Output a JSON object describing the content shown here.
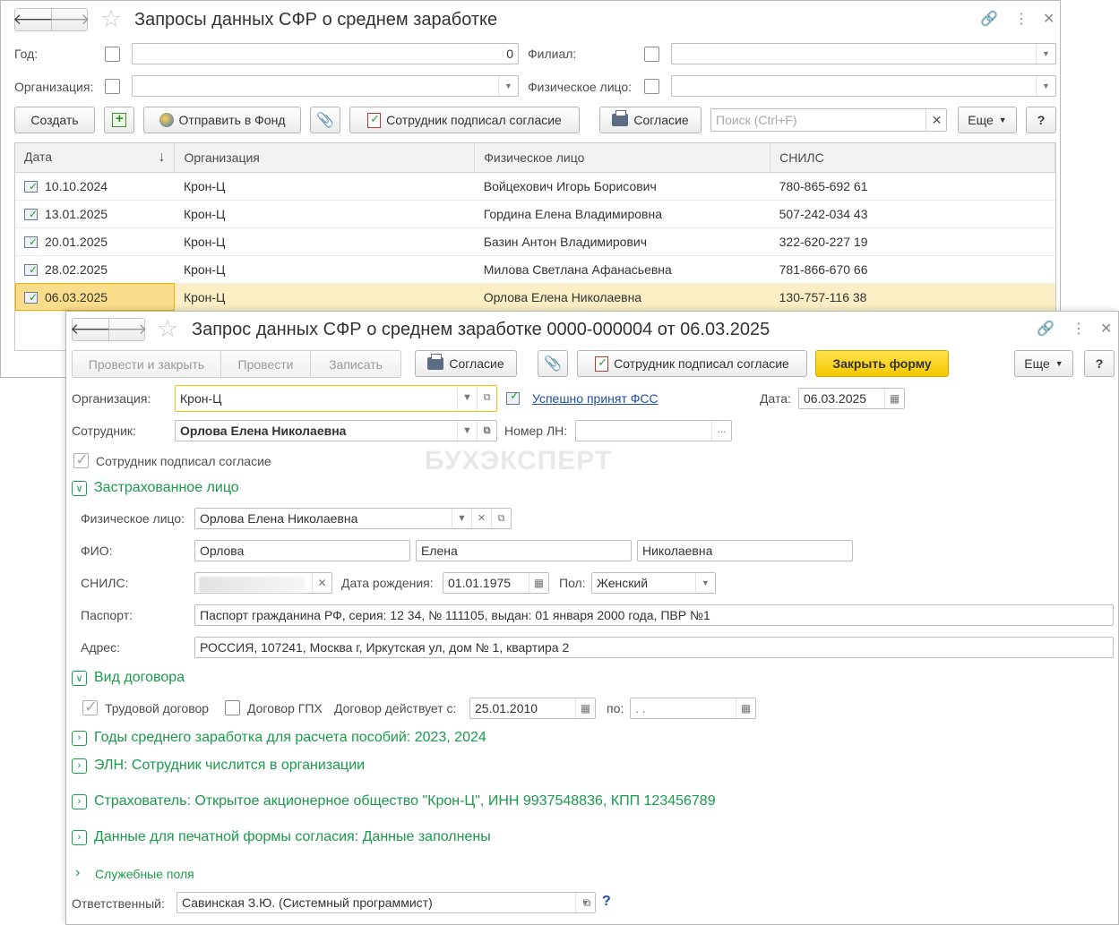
{
  "list_window": {
    "title": "Запросы данных СФР о среднем заработке",
    "filters": {
      "year_label": "Год:",
      "year_value": "0",
      "branch_label": "Филиал:",
      "org_label": "Организация:",
      "person_label": "Физическое лицо:"
    },
    "toolbar": {
      "create": "Создать",
      "send": "Отправить в Фонд",
      "signed": "Сотрудник подписал согласие",
      "consent": "Согласие",
      "search_placeholder": "Поиск (Ctrl+F)",
      "more": "Еще",
      "help": "?"
    },
    "table": {
      "headers": [
        "Дата",
        "Организация",
        "Физическое лицо",
        "СНИЛС"
      ],
      "sort_icon": "↓",
      "rows": [
        {
          "date": "10.10.2024",
          "org": "Крон-Ц",
          "person": "Войцехович Игорь Борисович",
          "snils": "780-865-692 61"
        },
        {
          "date": "13.01.2025",
          "org": "Крон-Ц",
          "person": "Гордина Елена Владимировна",
          "snils": "507-242-034 43"
        },
        {
          "date": "20.01.2025",
          "org": "Крон-Ц",
          "person": "Базин Антон Владимирович",
          "snils": "322-620-227 19"
        },
        {
          "date": "28.02.2025",
          "org": "Крон-Ц",
          "person": "Милова Светлана Афанасьевна",
          "snils": "781-866-670 66"
        },
        {
          "date": "06.03.2025",
          "org": "Крон-Ц",
          "person": "Орлова Елена Николаевна",
          "snils": "130-757-116 38"
        }
      ]
    }
  },
  "doc_window": {
    "title": "Запрос данных СФР о среднем заработке 0000-000004 от 06.03.2025",
    "toolbar": {
      "post_close": "Провести и закрыть",
      "post": "Провести",
      "save": "Записать",
      "consent": "Согласие",
      "signed": "Сотрудник подписал согласие",
      "close_form": "Закрыть форму",
      "more": "Еще",
      "help": "?"
    },
    "org_label": "Организация:",
    "org_value": "Крон-Ц",
    "status_link": "Успешно принят ФСС",
    "date_label": "Дата:",
    "date_value": "06.03.2025",
    "employee_label": "Сотрудник:",
    "employee_value": "Орлова Елена Николаевна",
    "ln_label": "Номер ЛН:",
    "ln_btn": "...",
    "signed_checkbox": "Сотрудник подписал согласие",
    "watermark": "БУХЭКСПЕРТ",
    "insured": {
      "section": "Застрахованное лицо",
      "person_label": "Физическое лицо:",
      "person_value": "Орлова Елена Николаевна",
      "fio_label": "ФИО:",
      "last": "Орлова",
      "first": "Елена",
      "middle": "Николаевна",
      "snils_label": "СНИЛС:",
      "birth_label": "Дата рождения:",
      "birth_value": "01.01.1975",
      "sex_label": "Пол:",
      "sex_value": "Женский",
      "passport_label": "Паспорт:",
      "passport_value": "Паспорт гражданина РФ, серия: 12 34, № 111105, выдан: 01 января 2000 года, ПВР №1",
      "address_label": "Адрес:",
      "address_value": "РОССИЯ, 107241, Москва г, Иркутская ул, дом № 1, квартира 2"
    },
    "contract": {
      "section": "Вид договора",
      "labor": "Трудовой договор",
      "gph": "Договор ГПХ",
      "from_label": "Договор действует с:",
      "from_value": "25.01.2010",
      "to_label": "по:",
      "to_value": " .  ."
    },
    "sections": {
      "years": "Годы среднего заработка для расчета пособий: 2023, 2024",
      "eln": "ЭЛН: Сотрудник числится в организации",
      "insurer": "Страхователь: Открытое акционерное общество \"Крон-Ц\", ИНН 9937548836, КПП 123456789",
      "print_data": "Данные для печатной формы согласия: Данные заполнены",
      "service": "Служебные поля"
    },
    "responsible_label": "Ответственный:",
    "responsible_value": "Савинская З.Ю. (Системный программист)",
    "responsible_help": "?"
  },
  "colors": {
    "accent_green": "#1a9a4a",
    "link_blue": "#1f4e9c",
    "selected_row": "#fbeec4",
    "yellow_button": "#f5c800"
  }
}
